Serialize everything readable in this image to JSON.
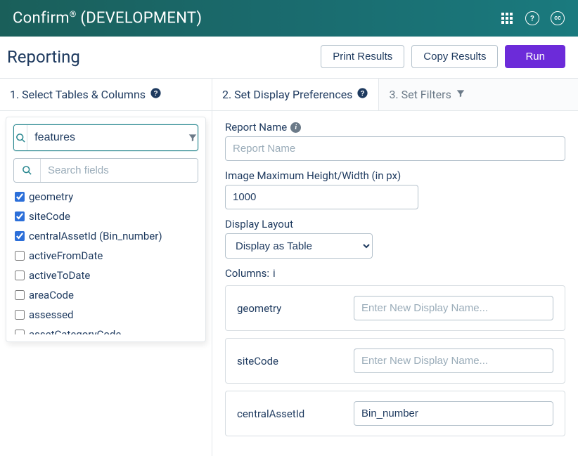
{
  "header": {
    "brand_name": "Confirm",
    "brand_sup": "®",
    "env": " (DEVELOPMENT)",
    "help_label": "?",
    "cc_label": "cc"
  },
  "subhead": {
    "title": "Reporting",
    "print": "Print Results",
    "copy": "Copy Results",
    "run": "Run"
  },
  "left": {
    "tab_title": "1. Select Tables & Columns",
    "table_search_value": "features",
    "field_search_placeholder": "Search fields",
    "fields": [
      {
        "label": "geometry",
        "checked": true
      },
      {
        "label": "siteCode",
        "checked": true
      },
      {
        "label": "centralAssetId (Bin_number)",
        "checked": true
      },
      {
        "label": "activeFromDate",
        "checked": false
      },
      {
        "label": "activeToDate",
        "checked": false
      },
      {
        "label": "areaCode",
        "checked": false
      },
      {
        "label": "assessed",
        "checked": false
      },
      {
        "label": "assetCategoryCode",
        "checked": false
      }
    ]
  },
  "right": {
    "tab2": "2. Set Display Preferences",
    "tab3": "3. Set Filters",
    "form": {
      "reportname_label": "Report Name",
      "reportname_placeholder": "Report Name",
      "imgmax_label": "Image Maximum Height/Width (in px)",
      "imgmax_value": "1000",
      "layout_label": "Display Layout",
      "layout_value": "Display as Table",
      "columns_label": "Columns:",
      "columns": [
        {
          "name": "geometry",
          "value": "",
          "placeholder": "Enter New Display Name..."
        },
        {
          "name": "siteCode",
          "value": "",
          "placeholder": "Enter New Display Name..."
        },
        {
          "name": "centralAssetId",
          "value": "Bin_number",
          "placeholder": ""
        }
      ]
    }
  }
}
